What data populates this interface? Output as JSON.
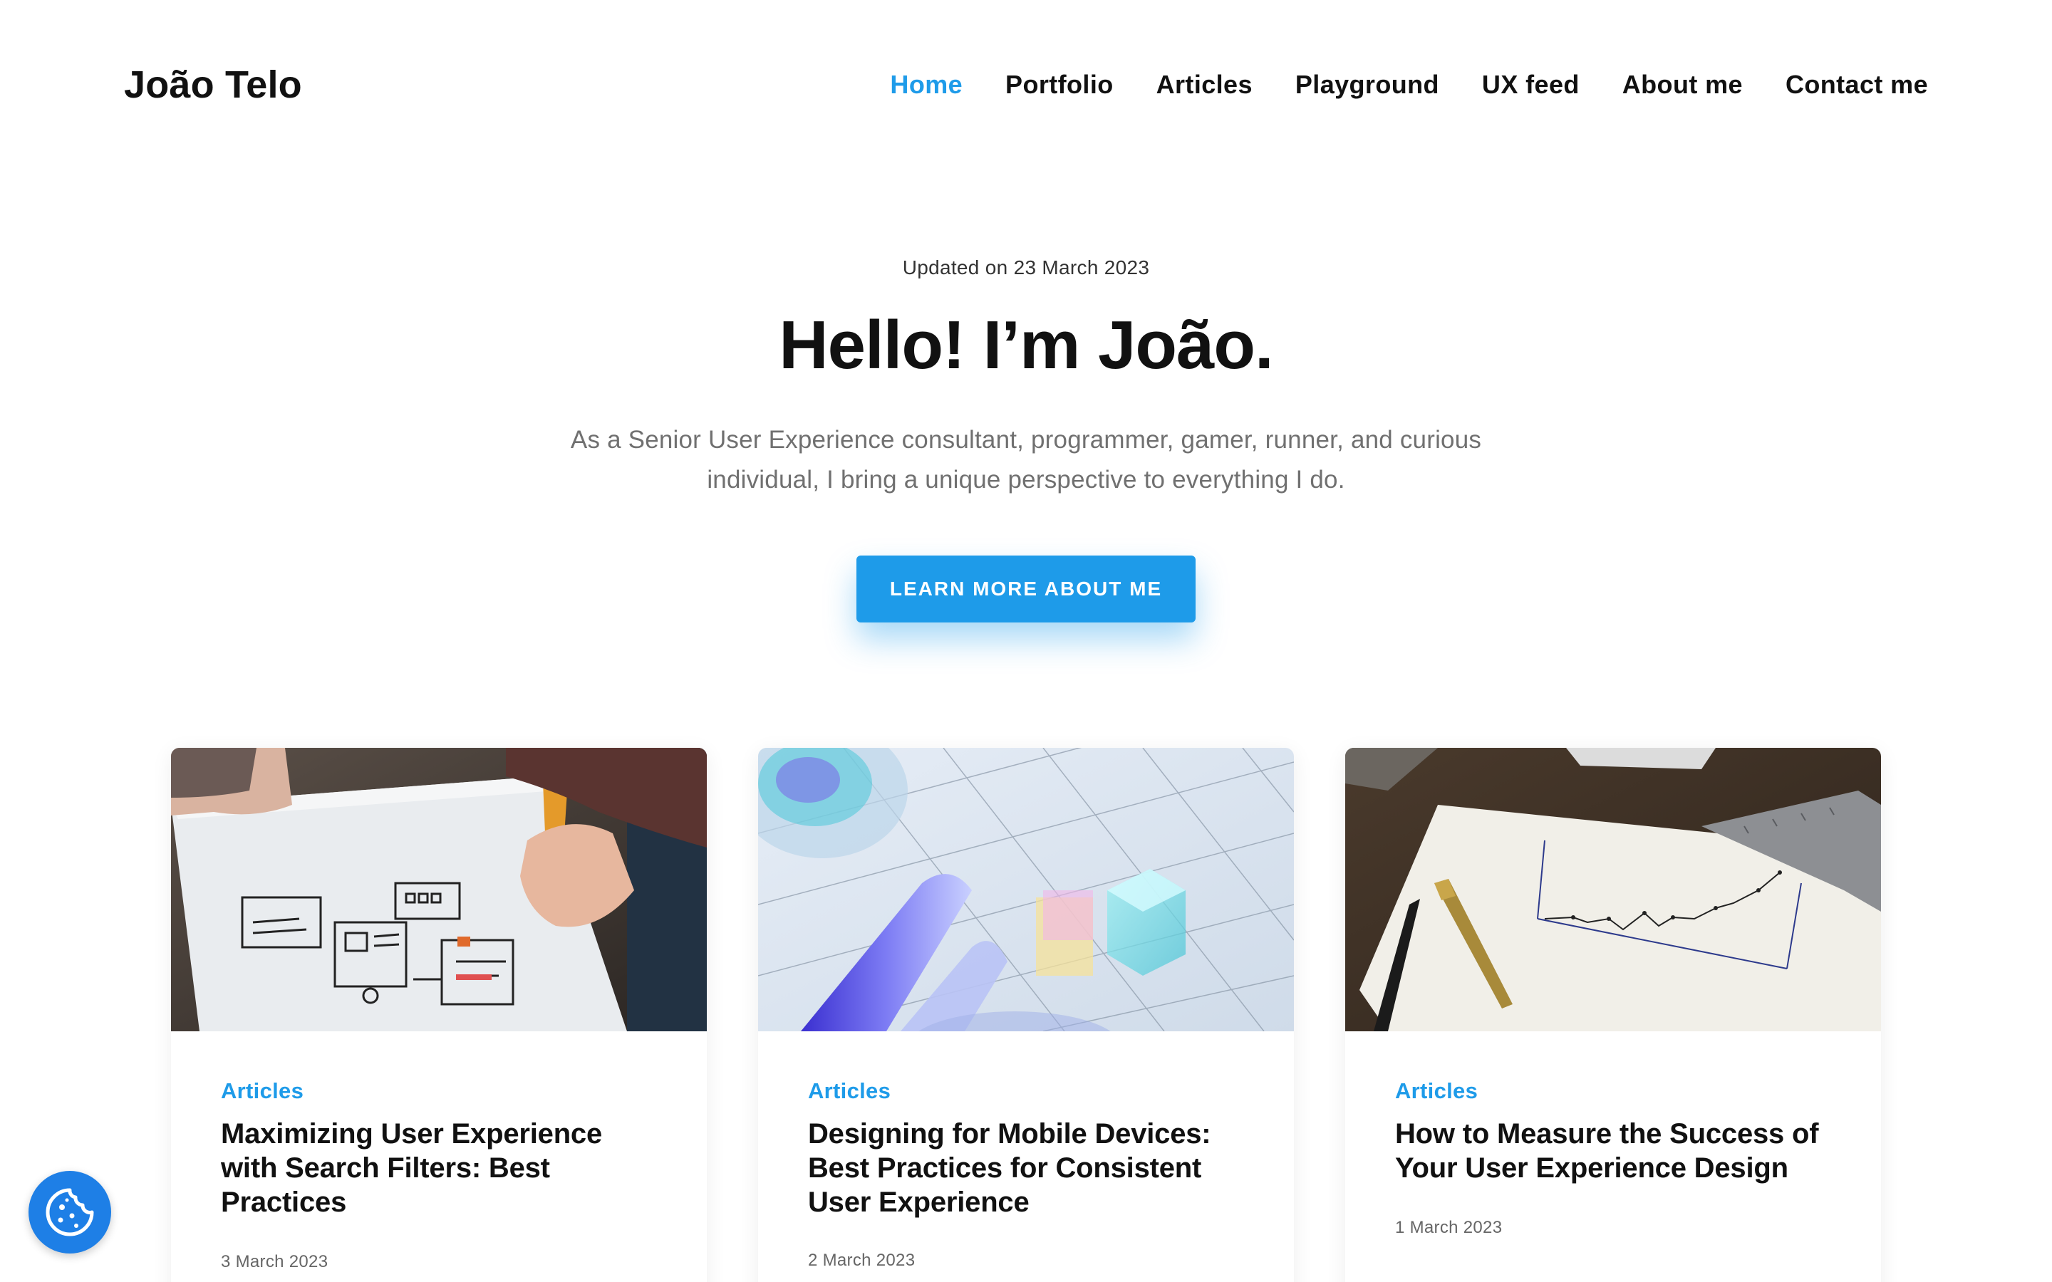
{
  "header": {
    "logo": "João Telo",
    "nav": [
      {
        "label": "Home",
        "active": true
      },
      {
        "label": "Portfolio"
      },
      {
        "label": "Articles"
      },
      {
        "label": "Playground"
      },
      {
        "label": "UX feed"
      },
      {
        "label": "About me"
      },
      {
        "label": "Contact me"
      }
    ]
  },
  "hero": {
    "updated": "Updated on 23 March 2023",
    "title": "Hello! I’m João.",
    "subtitle": "As a Senior User Experience consultant, programmer, gamer, runner, and curious individual, I bring a unique perspective to everything I do.",
    "cta": "LEARN MORE ABOUT ME"
  },
  "cards": [
    {
      "category": "Articles",
      "title": "Maximizing User Experience with Search Filters: Best Practices",
      "date": "3 March 2023",
      "image_icon": "wireframe-sketch-photo"
    },
    {
      "category": "Articles",
      "title": "Designing for Mobile Devices: Best Practices for Consistent User Experience",
      "date": "2 March 2023",
      "image_icon": "glass-shapes-render"
    },
    {
      "category": "Articles",
      "title": "How to Measure the Success of Your User Experience Design",
      "date": "1 March 2023",
      "image_icon": "chart-sketch-photo"
    }
  ],
  "colors": {
    "accent": "#1e9be9",
    "cookie": "#1e7fe6",
    "text": "#111111",
    "muted": "#707070"
  },
  "cookie_button": {
    "icon": "cookie-icon"
  }
}
